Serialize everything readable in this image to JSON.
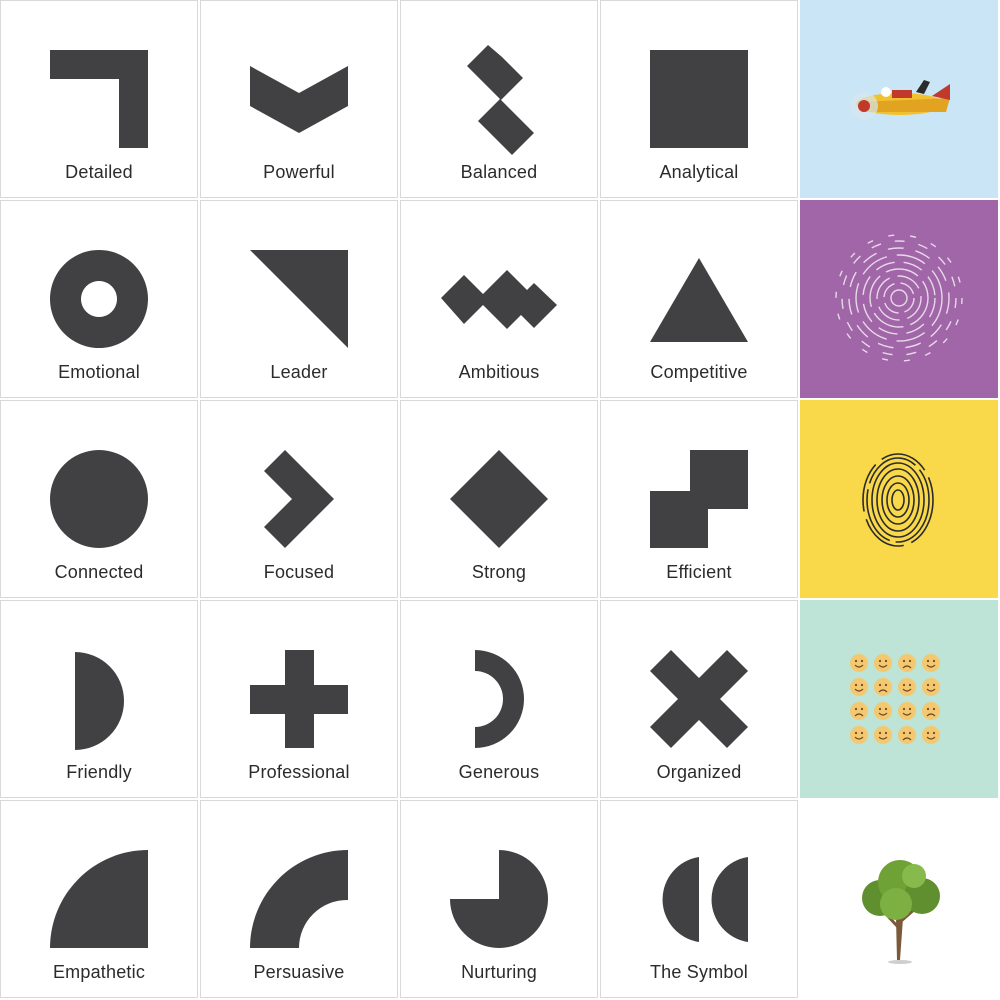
{
  "colors": {
    "shape": "#414143",
    "label": "#2b2b2b",
    "card_border": "#d9d9d9",
    "sky": "#c9e5f6",
    "purple": "#a166a8",
    "yellow": "#f9d84a",
    "mint": "#bde4d6",
    "white": "#ffffff"
  },
  "cards": [
    {
      "label": "Detailed",
      "icon": "corner-bracket-icon"
    },
    {
      "label": "Powerful",
      "icon": "chevron-down-icon"
    },
    {
      "label": "Balanced",
      "icon": "zigzag-s-icon"
    },
    {
      "label": "Analytical",
      "icon": "square-icon"
    },
    {
      "label": "Emotional",
      "icon": "ring-icon"
    },
    {
      "label": "Leader",
      "icon": "right-triangle-icon"
    },
    {
      "label": "Ambitious",
      "icon": "zigzag-wave-icon"
    },
    {
      "label": "Competitive",
      "icon": "triangle-icon"
    },
    {
      "label": "Connected",
      "icon": "circle-icon"
    },
    {
      "label": "Focused",
      "icon": "chevron-right-icon"
    },
    {
      "label": "Strong",
      "icon": "diamond-icon"
    },
    {
      "label": "Efficient",
      "icon": "stepped-squares-icon"
    },
    {
      "label": "Friendly",
      "icon": "half-circle-icon"
    },
    {
      "label": "Professional",
      "icon": "plus-icon"
    },
    {
      "label": "Generous",
      "icon": "half-ring-icon"
    },
    {
      "label": "Organized",
      "icon": "x-cross-icon"
    },
    {
      "label": "Empathetic",
      "icon": "quarter-circle-icon"
    },
    {
      "label": "Persuasive",
      "icon": "quarter-arc-icon"
    },
    {
      "label": "Nurturing",
      "icon": "pac-circle-icon"
    },
    {
      "label": "The Symbol",
      "icon": "double-half-circles-icon"
    }
  ],
  "photos": [
    {
      "icon": "airplane-icon",
      "background": "#c9e5f6"
    },
    {
      "icon": "maze-icon",
      "background": "#a166a8"
    },
    {
      "icon": "fingerprint-icon",
      "background": "#f9d84a"
    },
    {
      "icon": "emoji-faces-icon",
      "background": "#bde4d6"
    },
    {
      "icon": "tree-icon",
      "background": "#ffffff"
    }
  ]
}
